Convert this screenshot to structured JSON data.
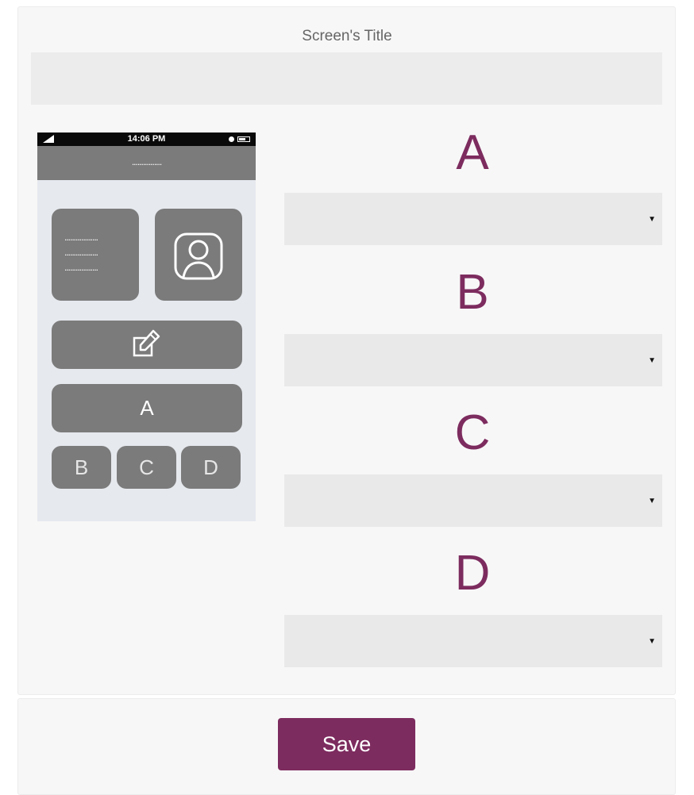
{
  "screen_title": "Screen's Title",
  "title_input": {
    "value": "",
    "placeholder": ""
  },
  "phone": {
    "status_time": "14:06 PM",
    "header_text": "................",
    "detail_lines": [
      "..................",
      "..................",
      ".................."
    ],
    "tiles": {
      "a": "A",
      "b": "B",
      "c": "C",
      "d": "D"
    },
    "icons": [
      "signal-icon",
      "alarm-icon",
      "battery-icon",
      "user-avatar-icon",
      "edit-icon"
    ]
  },
  "fields": [
    {
      "label": "A",
      "selected": ""
    },
    {
      "label": "B",
      "selected": ""
    },
    {
      "label": "C",
      "selected": ""
    },
    {
      "label": "D",
      "selected": ""
    }
  ],
  "caret_glyph": "▼",
  "save_label": "Save",
  "colors": {
    "accent": "#7d2c5f",
    "tile": "#7b7b7b",
    "phone_bg": "#e6e9ee"
  }
}
